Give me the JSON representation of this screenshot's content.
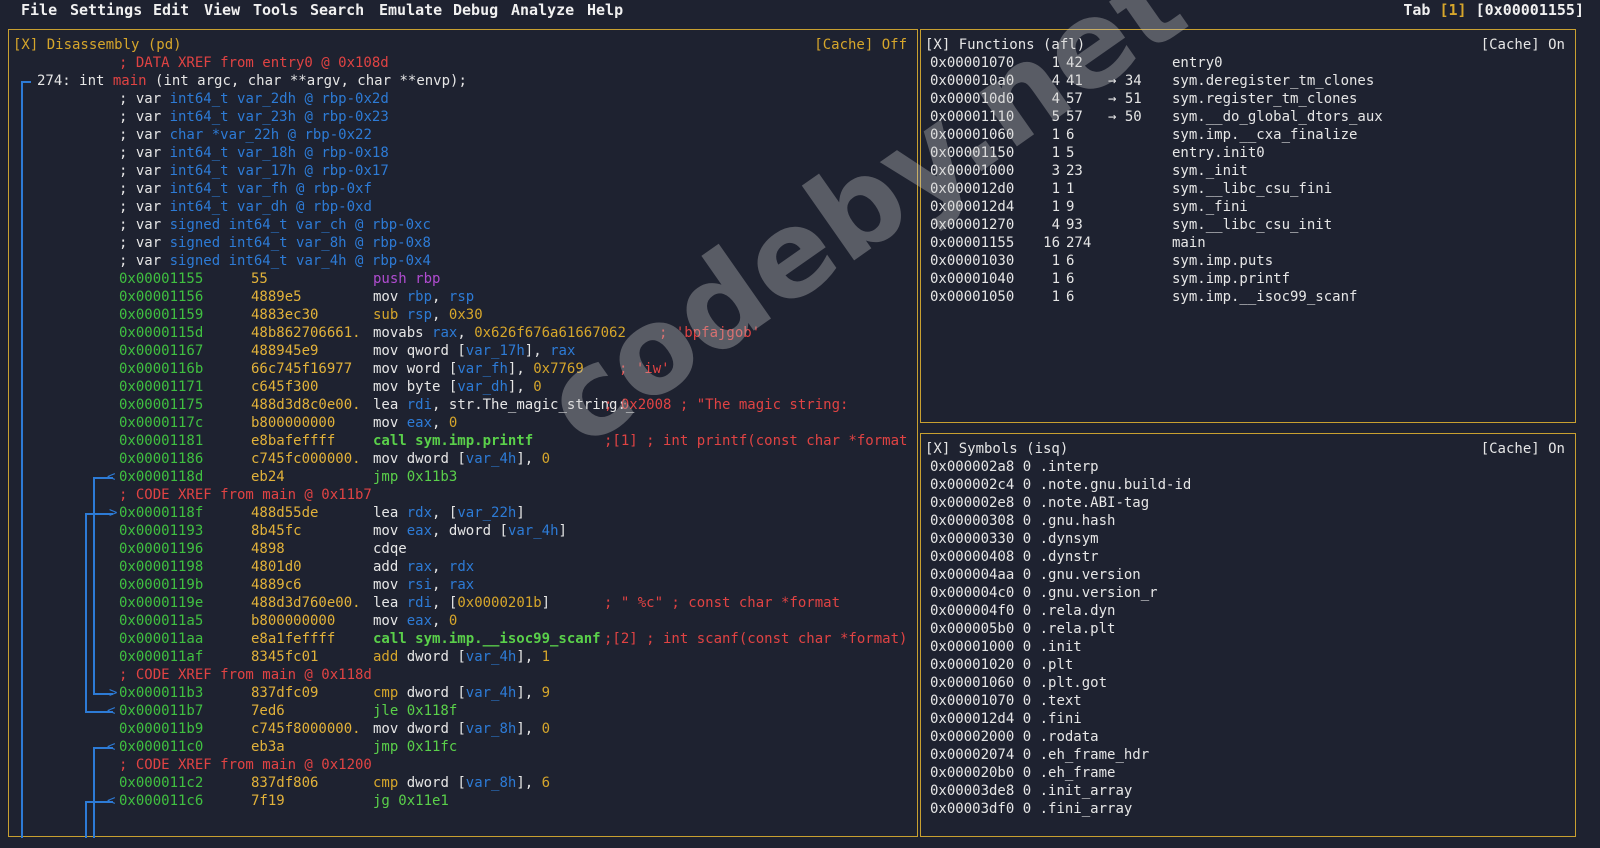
{
  "menu": [
    "File",
    "Settings",
    "Edit",
    "View",
    "Tools",
    "Search",
    "Emulate",
    "Debug",
    "Analyze",
    "Help"
  ],
  "tab": {
    "label": "Tab",
    "num": "[1]",
    "addr": "[0x00001155]"
  },
  "disasm": {
    "title": "[X] Disassembly (pd)",
    "cache": "[Cache] Off",
    "xref_top": "; DATA XREF from entry0 @ 0x108d",
    "signature_num": "274:",
    "signature_pre": " int ",
    "signature_fn": "main",
    "signature_post": " (int argc, char **argv, char **envp);",
    "vars": [
      {
        "type": "int64_t",
        "name": "var_2dh",
        "loc": "rbp-0x2d"
      },
      {
        "type": "int64_t",
        "name": "var_23h",
        "loc": "rbp-0x23"
      },
      {
        "type": "char *var_22h",
        "name": "",
        "loc": "rbp-0x22"
      },
      {
        "type": "int64_t",
        "name": "var_18h",
        "loc": "rbp-0x18"
      },
      {
        "type": "int64_t",
        "name": "var_17h",
        "loc": "rbp-0x17"
      },
      {
        "type": "int64_t",
        "name": "var_fh",
        "loc": "rbp-0xf"
      },
      {
        "type": "int64_t",
        "name": "var_dh",
        "loc": "rbp-0xd"
      },
      {
        "type": "signed int64_t",
        "name": "var_ch",
        "loc": "rbp-0xc"
      },
      {
        "type": "signed int64_t",
        "name": "var_8h",
        "loc": "rbp-0x8"
      },
      {
        "type": "signed int64_t",
        "name": "var_4h",
        "loc": "rbp-0x4"
      }
    ],
    "lines": [
      {
        "addr": "0x00001155",
        "bytes": "55",
        "instr": "push rbp",
        "cmt": ""
      },
      {
        "addr": "0x00001156",
        "bytes": "4889e5",
        "instr": "mov rbp, rsp",
        "cmt": ""
      },
      {
        "addr": "0x00001159",
        "bytes": "4883ec30",
        "instr": "sub rsp, 0x30",
        "cmt": ""
      },
      {
        "addr": "0x0000115d",
        "bytes": "48b862706661.",
        "instr": "movabs rax, 0x626f676a61667062",
        "cmt": "; 'bpfajgob'"
      },
      {
        "addr": "0x00001167",
        "bytes": "488945e9",
        "instr": "mov qword [var_17h], rax",
        "cmt": ""
      },
      {
        "addr": "0x0000116b",
        "bytes": "66c745f16977",
        "instr": "mov word [var_fh], 0x7769",
        "cmt": "; 'iw'"
      },
      {
        "addr": "0x00001171",
        "bytes": "c645f300",
        "instr": "mov byte [var_dh], 0",
        "cmt": ""
      },
      {
        "addr": "0x00001175",
        "bytes": "488d3d8c0e00.",
        "instr": "lea rdi, str.The_magic_string:_",
        "cmt": "; 0x2008 ; \"The magic string:"
      },
      {
        "addr": "0x0000117c",
        "bytes": "b800000000",
        "instr": "mov eax, 0",
        "cmt": ""
      },
      {
        "addr": "0x00001181",
        "bytes": "e8bafeffff",
        "instr": "call sym.imp.printf",
        "cmt": ";[1] ; int printf(const char *format"
      },
      {
        "addr": "0x00001186",
        "bytes": "c745fc000000.",
        "instr": "mov dword [var_4h], 0",
        "cmt": ""
      },
      {
        "addr": "0x0000118d",
        "bytes": "eb24",
        "instr": "jmp 0x11b3",
        "cmt": ""
      },
      {
        "addr": "",
        "bytes": "",
        "instr": "",
        "cmt": "; CODE XREF from main @ 0x11b7"
      },
      {
        "addr": "0x0000118f",
        "bytes": "488d55de",
        "instr": "lea rdx, [var_22h]",
        "cmt": ""
      },
      {
        "addr": "0x00001193",
        "bytes": "8b45fc",
        "instr": "mov eax, dword [var_4h]",
        "cmt": ""
      },
      {
        "addr": "0x00001196",
        "bytes": "4898",
        "instr": "cdqe",
        "cmt": ""
      },
      {
        "addr": "0x00001198",
        "bytes": "4801d0",
        "instr": "add rax, rdx",
        "cmt": ""
      },
      {
        "addr": "0x0000119b",
        "bytes": "4889c6",
        "instr": "mov rsi, rax",
        "cmt": ""
      },
      {
        "addr": "0x0000119e",
        "bytes": "488d3d760e00.",
        "instr": "lea rdi, [0x0000201b]",
        "cmt": "; \" %c\" ; const char *format"
      },
      {
        "addr": "0x000011a5",
        "bytes": "b800000000",
        "instr": "mov eax, 0",
        "cmt": ""
      },
      {
        "addr": "0x000011aa",
        "bytes": "e8a1feffff",
        "instr": "call sym.imp.__isoc99_scanf",
        "cmt": ";[2] ; int scanf(const char *format)"
      },
      {
        "addr": "0x000011af",
        "bytes": "8345fc01",
        "instr": "add dword [var_4h], 1",
        "cmt": ""
      },
      {
        "addr": "",
        "bytes": "",
        "instr": "",
        "cmt": "; CODE XREF from main @ 0x118d"
      },
      {
        "addr": "0x000011b3",
        "bytes": "837dfc09",
        "instr": "cmp dword [var_4h], 9",
        "cmt": ""
      },
      {
        "addr": "0x000011b7",
        "bytes": "7ed6",
        "instr": "jle 0x118f",
        "cmt": ""
      },
      {
        "addr": "0x000011b9",
        "bytes": "c745f8000000.",
        "instr": "mov dword [var_8h], 0",
        "cmt": ""
      },
      {
        "addr": "0x000011c0",
        "bytes": "eb3a",
        "instr": "jmp 0x11fc",
        "cmt": ""
      },
      {
        "addr": "",
        "bytes": "",
        "instr": "",
        "cmt": "; CODE XREF from main @ 0x1200"
      },
      {
        "addr": "0x000011c2",
        "bytes": "837df806",
        "instr": "cmp dword [var_8h], 6",
        "cmt": ""
      },
      {
        "addr": "0x000011c6",
        "bytes": "7f19",
        "instr": "jg 0x11e1",
        "cmt": ""
      }
    ]
  },
  "functions": {
    "title": "[X]   Functions (afl)",
    "cache": "[Cache] On",
    "rows": [
      {
        "addr": "0x00001070",
        "nbbs": "1",
        "size": "42",
        "calls": "",
        "name": "entry0"
      },
      {
        "addr": "0x000010a0",
        "nbbs": "4",
        "size": "41",
        "calls": "→ 34",
        "name": "sym.deregister_tm_clones"
      },
      {
        "addr": "0x000010d0",
        "nbbs": "4",
        "size": "57",
        "calls": "→ 51",
        "name": "sym.register_tm_clones"
      },
      {
        "addr": "0x00001110",
        "nbbs": "5",
        "size": "57",
        "calls": "→ 50",
        "name": "sym.__do_global_dtors_aux"
      },
      {
        "addr": "0x00001060",
        "nbbs": "1",
        "size": "6",
        "calls": "",
        "name": "sym.imp.__cxa_finalize"
      },
      {
        "addr": "0x00001150",
        "nbbs": "1",
        "size": "5",
        "calls": "",
        "name": "entry.init0"
      },
      {
        "addr": "0x00001000",
        "nbbs": "3",
        "size": "23",
        "calls": "",
        "name": "sym._init"
      },
      {
        "addr": "0x000012d0",
        "nbbs": "1",
        "size": "1",
        "calls": "",
        "name": "sym.__libc_csu_fini"
      },
      {
        "addr": "0x000012d4",
        "nbbs": "1",
        "size": "9",
        "calls": "",
        "name": "sym._fini"
      },
      {
        "addr": "0x00001270",
        "nbbs": "4",
        "size": "93",
        "calls": "",
        "name": "sym.__libc_csu_init"
      },
      {
        "addr": "0x00001155",
        "nbbs": "16",
        "size": "274",
        "calls": "",
        "name": "main"
      },
      {
        "addr": "0x00001030",
        "nbbs": "1",
        "size": "6",
        "calls": "",
        "name": "sym.imp.puts"
      },
      {
        "addr": "0x00001040",
        "nbbs": "1",
        "size": "6",
        "calls": "",
        "name": "sym.imp.printf"
      },
      {
        "addr": "0x00001050",
        "nbbs": "1",
        "size": "6",
        "calls": "",
        "name": "sym.imp.__isoc99_scanf"
      }
    ]
  },
  "symbols": {
    "title": "[X]   Symbols (isq)",
    "cache": "[Cache] On",
    "rows": [
      {
        "addr": "0x000002a8",
        "size": "0",
        "name": ".interp"
      },
      {
        "addr": "0x000002c4",
        "size": "0",
        "name": ".note.gnu.build-id"
      },
      {
        "addr": "0x000002e8",
        "size": "0",
        "name": ".note.ABI-tag"
      },
      {
        "addr": "0x00000308",
        "size": "0",
        "name": ".gnu.hash"
      },
      {
        "addr": "0x00000330",
        "size": "0",
        "name": ".dynsym"
      },
      {
        "addr": "0x00000408",
        "size": "0",
        "name": ".dynstr"
      },
      {
        "addr": "0x000004aa",
        "size": "0",
        "name": ".gnu.version"
      },
      {
        "addr": "0x000004c0",
        "size": "0",
        "name": ".gnu.version_r"
      },
      {
        "addr": "0x000004f0",
        "size": "0",
        "name": ".rela.dyn"
      },
      {
        "addr": "0x000005b0",
        "size": "0",
        "name": ".rela.plt"
      },
      {
        "addr": "0x00001000",
        "size": "0",
        "name": ".init"
      },
      {
        "addr": "0x00001020",
        "size": "0",
        "name": ".plt"
      },
      {
        "addr": "0x00001060",
        "size": "0",
        "name": ".plt.got"
      },
      {
        "addr": "0x00001070",
        "size": "0",
        "name": ".text"
      },
      {
        "addr": "0x000012d4",
        "size": "0",
        "name": ".fini"
      },
      {
        "addr": "0x00002000",
        "size": "0",
        "name": ".rodata"
      },
      {
        "addr": "0x00002074",
        "size": "0",
        "name": ".eh_frame_hdr"
      },
      {
        "addr": "0x000020b0",
        "size": "0",
        "name": ".eh_frame"
      },
      {
        "addr": "0x00003de8",
        "size": "0",
        "name": ".init_array"
      },
      {
        "addr": "0x00003df0",
        "size": "0",
        "name": ".fini_array"
      }
    ]
  },
  "watermark": "codeby.net",
  "colors": {
    "border": "#c8a030",
    "background": "#1e2230",
    "address": "#40c040",
    "bytes": "#d6a62b",
    "comment": "#e04343",
    "register": "#2d7bd6",
    "call": "#5ad04a"
  }
}
